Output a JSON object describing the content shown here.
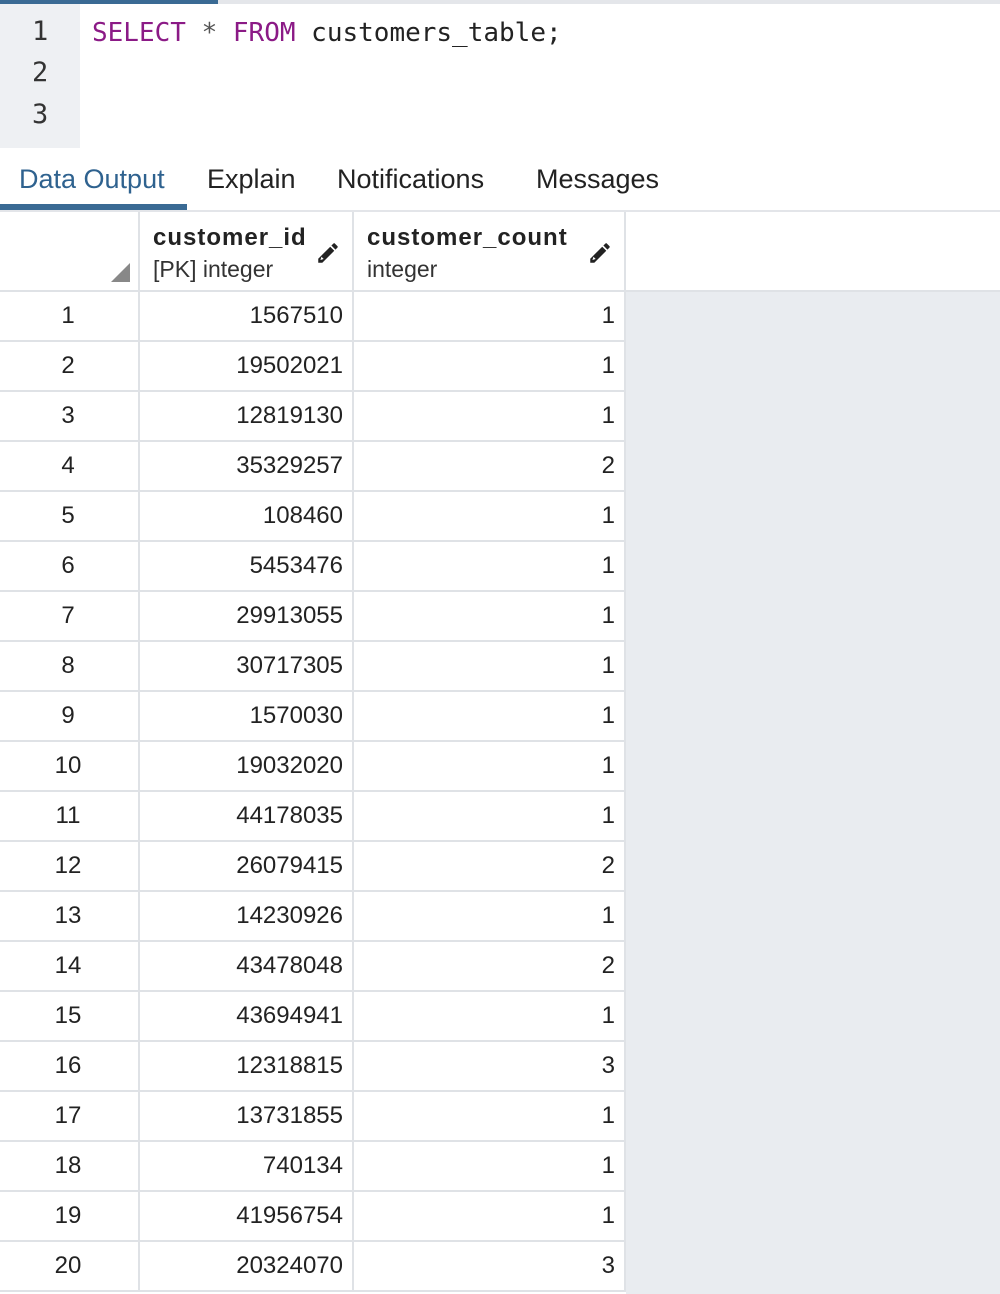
{
  "editor": {
    "line_numbers": [
      "1",
      "2",
      "3"
    ],
    "query": {
      "kw_select": "SELECT",
      "star": "*",
      "kw_from": "FROM",
      "table": "customers_table;"
    }
  },
  "tabs": [
    {
      "label": "Data Output",
      "active": true
    },
    {
      "label": "Explain",
      "active": false
    },
    {
      "label": "Notifications",
      "active": false
    },
    {
      "label": "Messages",
      "active": false
    }
  ],
  "grid": {
    "columns": [
      {
        "name": "customer_id",
        "type": "[PK] integer",
        "icon": "pencil-icon"
      },
      {
        "name": "customer_count",
        "type": "integer",
        "icon": "pencil-icon"
      }
    ],
    "rows": [
      {
        "num": "1",
        "customer_id": "1567510",
        "customer_count": "1"
      },
      {
        "num": "2",
        "customer_id": "19502021",
        "customer_count": "1"
      },
      {
        "num": "3",
        "customer_id": "12819130",
        "customer_count": "1"
      },
      {
        "num": "4",
        "customer_id": "35329257",
        "customer_count": "2"
      },
      {
        "num": "5",
        "customer_id": "108460",
        "customer_count": "1"
      },
      {
        "num": "6",
        "customer_id": "5453476",
        "customer_count": "1"
      },
      {
        "num": "7",
        "customer_id": "29913055",
        "customer_count": "1"
      },
      {
        "num": "8",
        "customer_id": "30717305",
        "customer_count": "1"
      },
      {
        "num": "9",
        "customer_id": "1570030",
        "customer_count": "1"
      },
      {
        "num": "10",
        "customer_id": "19032020",
        "customer_count": "1"
      },
      {
        "num": "11",
        "customer_id": "44178035",
        "customer_count": "1"
      },
      {
        "num": "12",
        "customer_id": "26079415",
        "customer_count": "2"
      },
      {
        "num": "13",
        "customer_id": "14230926",
        "customer_count": "1"
      },
      {
        "num": "14",
        "customer_id": "43478048",
        "customer_count": "2"
      },
      {
        "num": "15",
        "customer_id": "43694941",
        "customer_count": "1"
      },
      {
        "num": "16",
        "customer_id": "12318815",
        "customer_count": "3"
      },
      {
        "num": "17",
        "customer_id": "13731855",
        "customer_count": "1"
      },
      {
        "num": "18",
        "customer_id": "740134",
        "customer_count": "1"
      },
      {
        "num": "19",
        "customer_id": "41956754",
        "customer_count": "1"
      },
      {
        "num": "20",
        "customer_id": "20324070",
        "customer_count": "3"
      }
    ]
  },
  "colors": {
    "keyword": "#8b1a86",
    "accent": "#3a6a94",
    "empty_area": "#e9ecf0"
  }
}
